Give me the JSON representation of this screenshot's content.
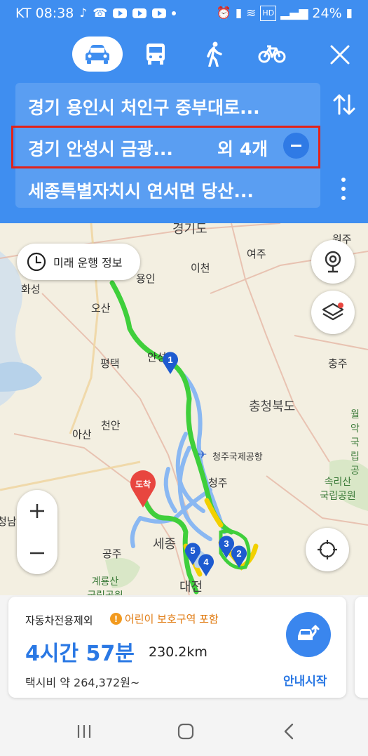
{
  "status_bar": {
    "carrier_time": "KT 08:38",
    "battery": "24%"
  },
  "modes": {
    "selected": "car",
    "items": [
      "car-icon",
      "bus-icon",
      "walk-icon",
      "bike-icon"
    ]
  },
  "route": {
    "origin": "경기 용인시 처인구 중부대로...",
    "via": "경기 안성시 금광...",
    "via_extra": "외 4개",
    "destination": "세종특별자치시 연서면 당산..."
  },
  "map": {
    "future_button": "미래 운행 정보",
    "labels": {
      "gyeonggi": "경기도",
      "wonju": "원주",
      "yeoju": "여주",
      "icheon": "이천",
      "yongin": "용인",
      "hwaseong": "화성",
      "osan": "오산",
      "pyeongtaek": "평택",
      "anseong": "안성",
      "chungju": "충주",
      "chungbuk": "충청북도",
      "asan": "아산",
      "cheonan": "천안",
      "cheongju_airport": "청주국제공항",
      "cheongju": "청주",
      "songnisan": "속리산\n국립공원",
      "woraksan": "월악\n국립공",
      "sejong": "세종",
      "gongju": "공주",
      "daejeon": "대전",
      "gyeryongsan": "계룡산\n국립공원",
      "cheongnam": "청남"
    },
    "arrival_marker": "도착",
    "waypoints": [
      "1",
      "2",
      "3",
      "4",
      "5"
    ],
    "route_colors": {
      "main": "#3fcf3b",
      "congested": "#f2d000",
      "alternative": "#8ab8f2"
    }
  },
  "summary": {
    "option_label": "자동차전용제외",
    "notice": "어린이 보호구역 포함",
    "duration": "4시간 57분",
    "distance": "230.2km",
    "fare": "택시비 약 264,372원~",
    "start_label": "안내시작"
  }
}
